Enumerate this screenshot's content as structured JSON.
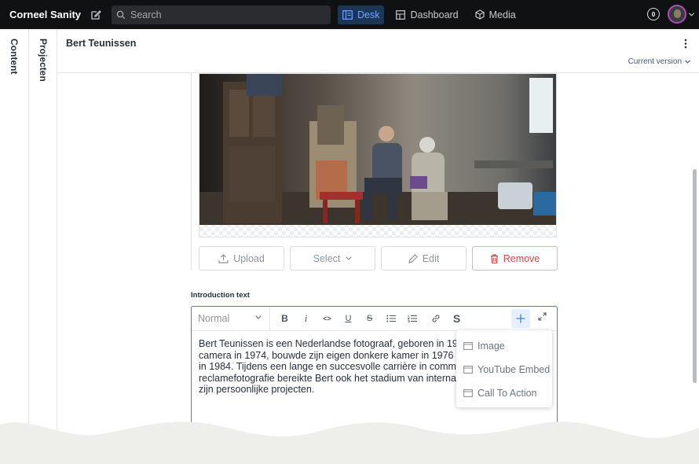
{
  "topbar": {
    "brand": "Corneel Sanity",
    "search_placeholder": "Search",
    "tools": [
      {
        "label": "Desk",
        "active": true
      },
      {
        "label": "Dashboard",
        "active": false
      },
      {
        "label": "Media",
        "active": false
      }
    ],
    "notification_count": "0"
  },
  "panes": {
    "first": "Content",
    "second": "Projecten"
  },
  "document": {
    "title": "Bert Teunissen",
    "version_label": "Current version"
  },
  "image_field": {
    "buttons": {
      "upload": "Upload",
      "select": "Select",
      "edit": "Edit",
      "remove": "Remove"
    }
  },
  "intro_field": {
    "label": "Introduction text",
    "style_select": "Normal",
    "toolbar": {
      "bold": "B",
      "italic": "i",
      "code": "<>",
      "underline": "U",
      "strike": "S",
      "special": "S"
    },
    "text_lines": [
      "Bert Teunissen is een Nederlandse fotograaf, geboren in 1959.",
      "camera in 1974, bouwde zijn eigen donkere kamer in 1976 en w",
      "in 1984. Tijdens een lange en succesvolle carrière in commerci",
      "reclamefotografie bereikte Bert ook het stadium van internation",
      "zijn persoonlijke projecten."
    ]
  },
  "insert_menu": {
    "items": [
      "Image",
      "YouTube Embed",
      "Call To Action"
    ]
  },
  "colors": {
    "topbar": "#101112",
    "accent": "#3f7fdb",
    "danger": "#d3454d"
  }
}
